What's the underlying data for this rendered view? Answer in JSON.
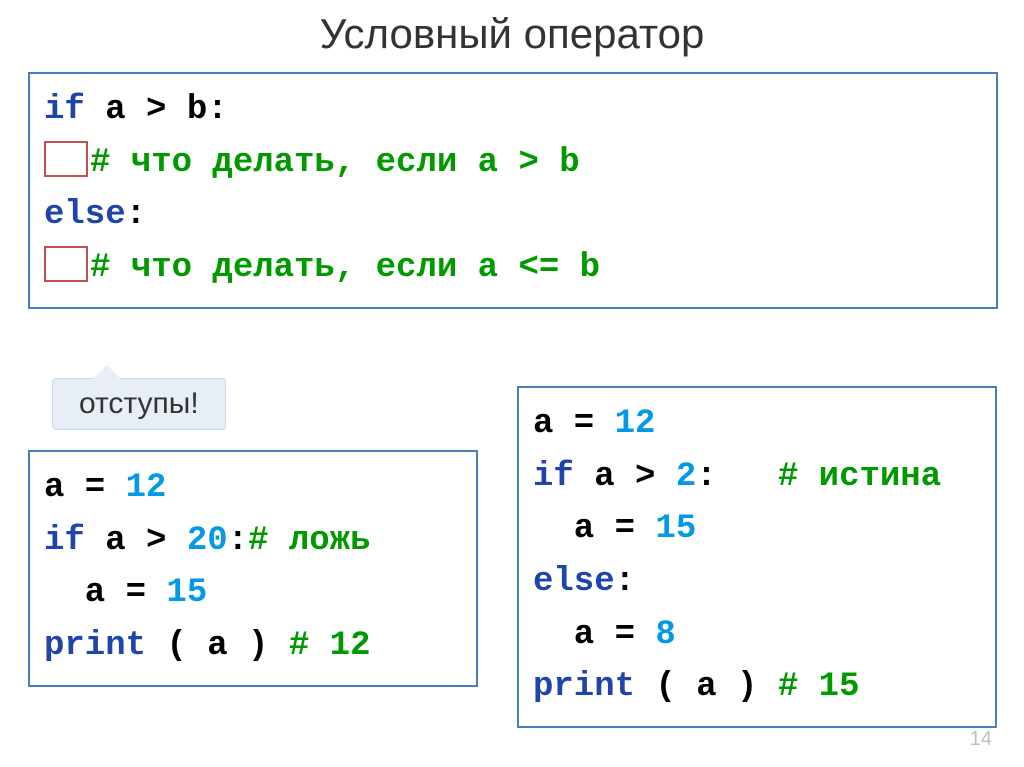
{
  "title": "Условный оператор",
  "top": {
    "line1": {
      "kw": "if",
      "rest": " a > b:"
    },
    "line2": "# что делать, если a > b",
    "line3": {
      "kw": "else",
      "rest": ":"
    },
    "line4": "# что делать, если a <= b"
  },
  "callout": "отступы!",
  "left": {
    "l1_a": "a = ",
    "l1_num": "12",
    "l2_kw": "if",
    "l2_rest": " a > ",
    "l2_num": "20",
    "l2_colon": ":",
    "l2_com": "# ложь",
    "l3_a": "  a = ",
    "l3_num": "15",
    "l4_kw": "print",
    "l4_rest": " ( a ) ",
    "l4_com": "# 12"
  },
  "right": {
    "l1_a": "a = ",
    "l1_num": "12",
    "l2_kw": "if",
    "l2_rest": " a > ",
    "l2_num": "2",
    "l2_colon": ":   ",
    "l2_com": "# истина",
    "l3_a": "  a = ",
    "l3_num": "15",
    "l4_kw": "else",
    "l4_rest": ":",
    "l5_a": "  a = ",
    "l5_num": "8",
    "l6_kw": "print",
    "l6_rest": " ( a ) ",
    "l6_com": "# 15"
  },
  "pagenum": "14"
}
